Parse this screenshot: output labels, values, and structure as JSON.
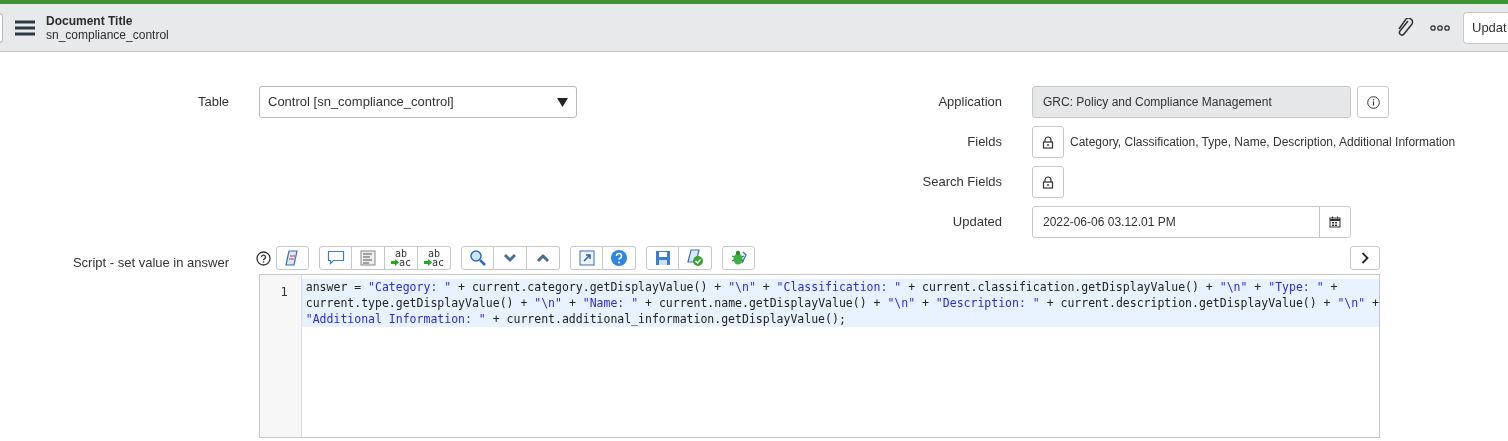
{
  "header": {
    "title": "Document Title",
    "subtitle": "sn_compliance_control",
    "update_button": "Updat"
  },
  "table_field": {
    "label": "Table",
    "value": "Control [sn_compliance_control]"
  },
  "application": {
    "label": "Application",
    "value": "GRC: Policy and Compliance Management"
  },
  "fields": {
    "label": "Fields",
    "value": "Category, Classification, Type, Name, Description, Additional Information"
  },
  "search_fields": {
    "label": "Search Fields"
  },
  "updated": {
    "label": "Updated",
    "value": "2022-06-06 03.12.01 PM"
  },
  "script": {
    "label": "Script - set value in answer",
    "toolbar": [
      [
        {
          "kind": "script"
        }
      ],
      [
        {
          "kind": "comment"
        },
        {
          "kind": "format"
        },
        {
          "kind": "replace",
          "top": "ab",
          "bottom": "ac"
        },
        {
          "kind": "replace_all",
          "top": "ab",
          "bottom": "ac"
        }
      ],
      [
        {
          "kind": "search"
        },
        {
          "kind": "down"
        },
        {
          "kind": "up"
        }
      ],
      [
        {
          "kind": "expand"
        },
        {
          "kind": "help"
        }
      ],
      [
        {
          "kind": "save"
        },
        {
          "kind": "check"
        }
      ],
      [
        {
          "kind": "debug"
        }
      ]
    ],
    "line_number": "1",
    "lines": [
      [
        {
          "kind": "plain",
          "text": "answer = "
        },
        {
          "kind": "string",
          "text": "\"Category: \""
        },
        {
          "kind": "plain",
          "text": " + current.category.getDisplayValue() + "
        },
        {
          "kind": "string",
          "text": "\"\\n\""
        },
        {
          "kind": "plain",
          "text": " + "
        },
        {
          "kind": "string",
          "text": "\"Classification: \""
        },
        {
          "kind": "plain",
          "text": " + current.classification.getDisplayValue() + "
        },
        {
          "kind": "string",
          "text": "\"\\n\""
        },
        {
          "kind": "plain",
          "text": " + "
        },
        {
          "kind": "string",
          "text": "\"Type: \""
        },
        {
          "kind": "plain",
          "text": " +"
        }
      ],
      [
        {
          "kind": "plain",
          "text": "current.type.getDisplayValue() + "
        },
        {
          "kind": "string",
          "text": "\"\\n\""
        },
        {
          "kind": "plain",
          "text": " + "
        },
        {
          "kind": "string",
          "text": "\"Name: \""
        },
        {
          "kind": "plain",
          "text": " + current.name.getDisplayValue() + "
        },
        {
          "kind": "string",
          "text": "\"\\n\""
        },
        {
          "kind": "plain",
          "text": " + "
        },
        {
          "kind": "string",
          "text": "\"Description: \""
        },
        {
          "kind": "plain",
          "text": " + current.description.getDisplayValue() + "
        },
        {
          "kind": "string",
          "text": "\"\\n\""
        },
        {
          "kind": "plain",
          "text": " +"
        }
      ],
      [
        {
          "kind": "string",
          "text": "\"Additional Information: \""
        },
        {
          "kind": "plain",
          "text": " + current.additional_information.getDisplayValue();"
        }
      ]
    ]
  }
}
